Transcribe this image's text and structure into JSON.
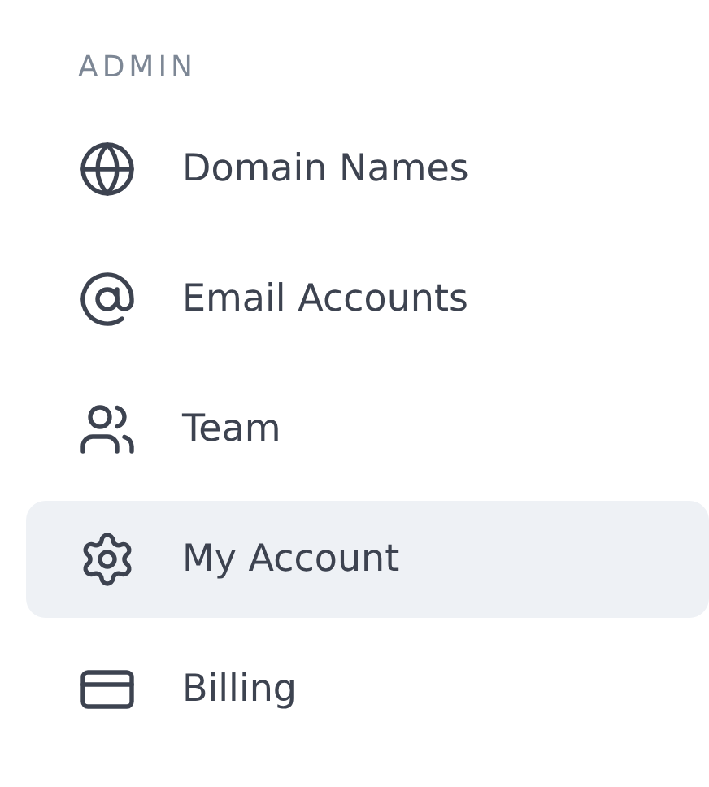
{
  "section_title": "ADMIN",
  "items": [
    {
      "kind": "globe",
      "label": "Domain Names",
      "selected": false
    },
    {
      "kind": "at",
      "label": "Email Accounts",
      "selected": false
    },
    {
      "kind": "team",
      "label": "Team",
      "selected": false
    },
    {
      "kind": "gear",
      "label": "My Account",
      "selected": true
    },
    {
      "kind": "card",
      "label": "Billing",
      "selected": false
    }
  ]
}
